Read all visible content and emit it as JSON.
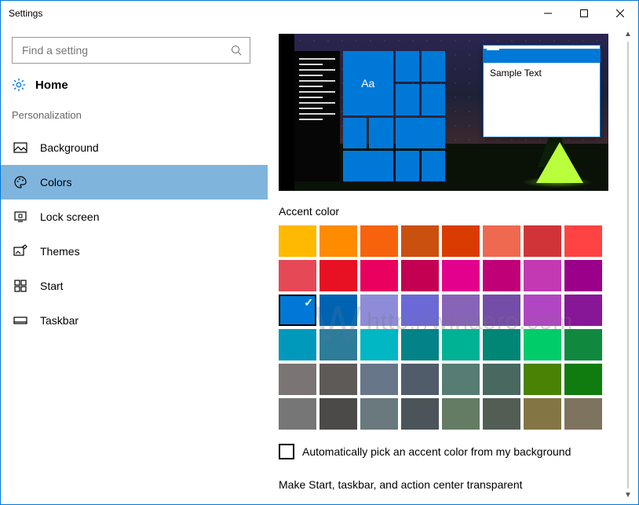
{
  "window": {
    "title": "Settings"
  },
  "search": {
    "placeholder": "Find a setting"
  },
  "home": {
    "label": "Home"
  },
  "section": {
    "label": "Personalization"
  },
  "nav": {
    "background": "Background",
    "colors": "Colors",
    "lockscreen": "Lock screen",
    "themes": "Themes",
    "start": "Start",
    "taskbar": "Taskbar"
  },
  "preview": {
    "tile_text": "Aa",
    "sample_text": "Sample Text"
  },
  "accent": {
    "label": "Accent color",
    "auto_label": "Automatically pick an accent color from my background",
    "selected_index": 16,
    "colors": [
      "#ffb900",
      "#ff8c00",
      "#f7630c",
      "#ca5010",
      "#da3b01",
      "#ef6950",
      "#d13438",
      "#ff4343",
      "#e74856",
      "#e81123",
      "#ea005e",
      "#c30052",
      "#e3008c",
      "#bf0077",
      "#c239b3",
      "#9a0089",
      "#0078d7",
      "#0063b1",
      "#8e8cd8",
      "#6b69d6",
      "#8764b8",
      "#744da9",
      "#b146c2",
      "#881798",
      "#0099bc",
      "#2d7d9a",
      "#00b7c3",
      "#038387",
      "#00b294",
      "#018574",
      "#00cc6a",
      "#10893e",
      "#7a7574",
      "#5d5a58",
      "#68768a",
      "#515c6b",
      "#567c73",
      "#486860",
      "#498205",
      "#107c10",
      "#767676",
      "#4c4a48",
      "#69797e",
      "#4a5459",
      "#647c64",
      "#525e54",
      "#847545",
      "#7e735f"
    ]
  },
  "truncated": {
    "label": "Make Start, taskbar, and action center transparent"
  },
  "watermark": {
    "text": "http://winaero.com"
  }
}
